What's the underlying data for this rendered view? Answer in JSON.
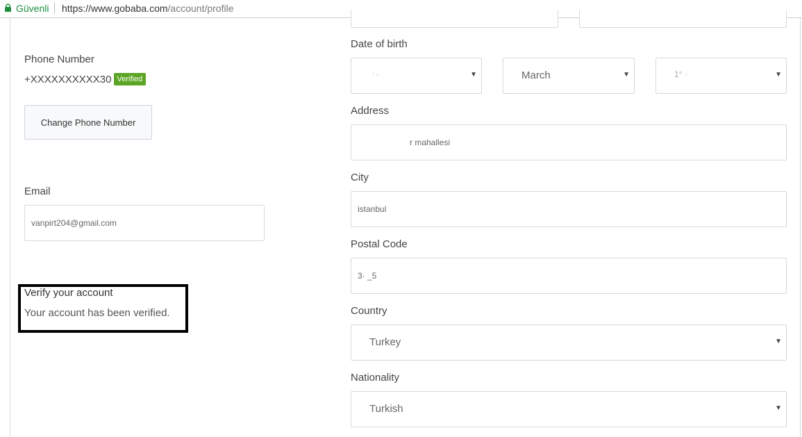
{
  "browser": {
    "secure_label": "Güvenli",
    "url_prefix": "https://www.gobaba.com",
    "url_path": "/account/profile"
  },
  "phone": {
    "label": "Phone Number",
    "value": "+XXXXXXXXXX30",
    "badge": "Verified",
    "change_button": "Change Phone Number"
  },
  "email": {
    "label": "Email",
    "value": "vanpirt204@gmail.com"
  },
  "verify": {
    "title": "Verify your account",
    "message": "Your account has been verified."
  },
  "dob": {
    "label": "Date of birth",
    "day": "· ,",
    "month": "March",
    "year": "1° ·"
  },
  "address": {
    "label": "Address",
    "value": "r mahallesi"
  },
  "city": {
    "label": "City",
    "value": "istanbul"
  },
  "postal": {
    "label": "Postal Code",
    "value": "3·  _5"
  },
  "country": {
    "label": "Country",
    "value": "Turkey"
  },
  "nationality": {
    "label": "Nationality",
    "value": "Turkish"
  },
  "colors": {
    "badge": "#5ba525",
    "secure": "#1e8e3e"
  }
}
